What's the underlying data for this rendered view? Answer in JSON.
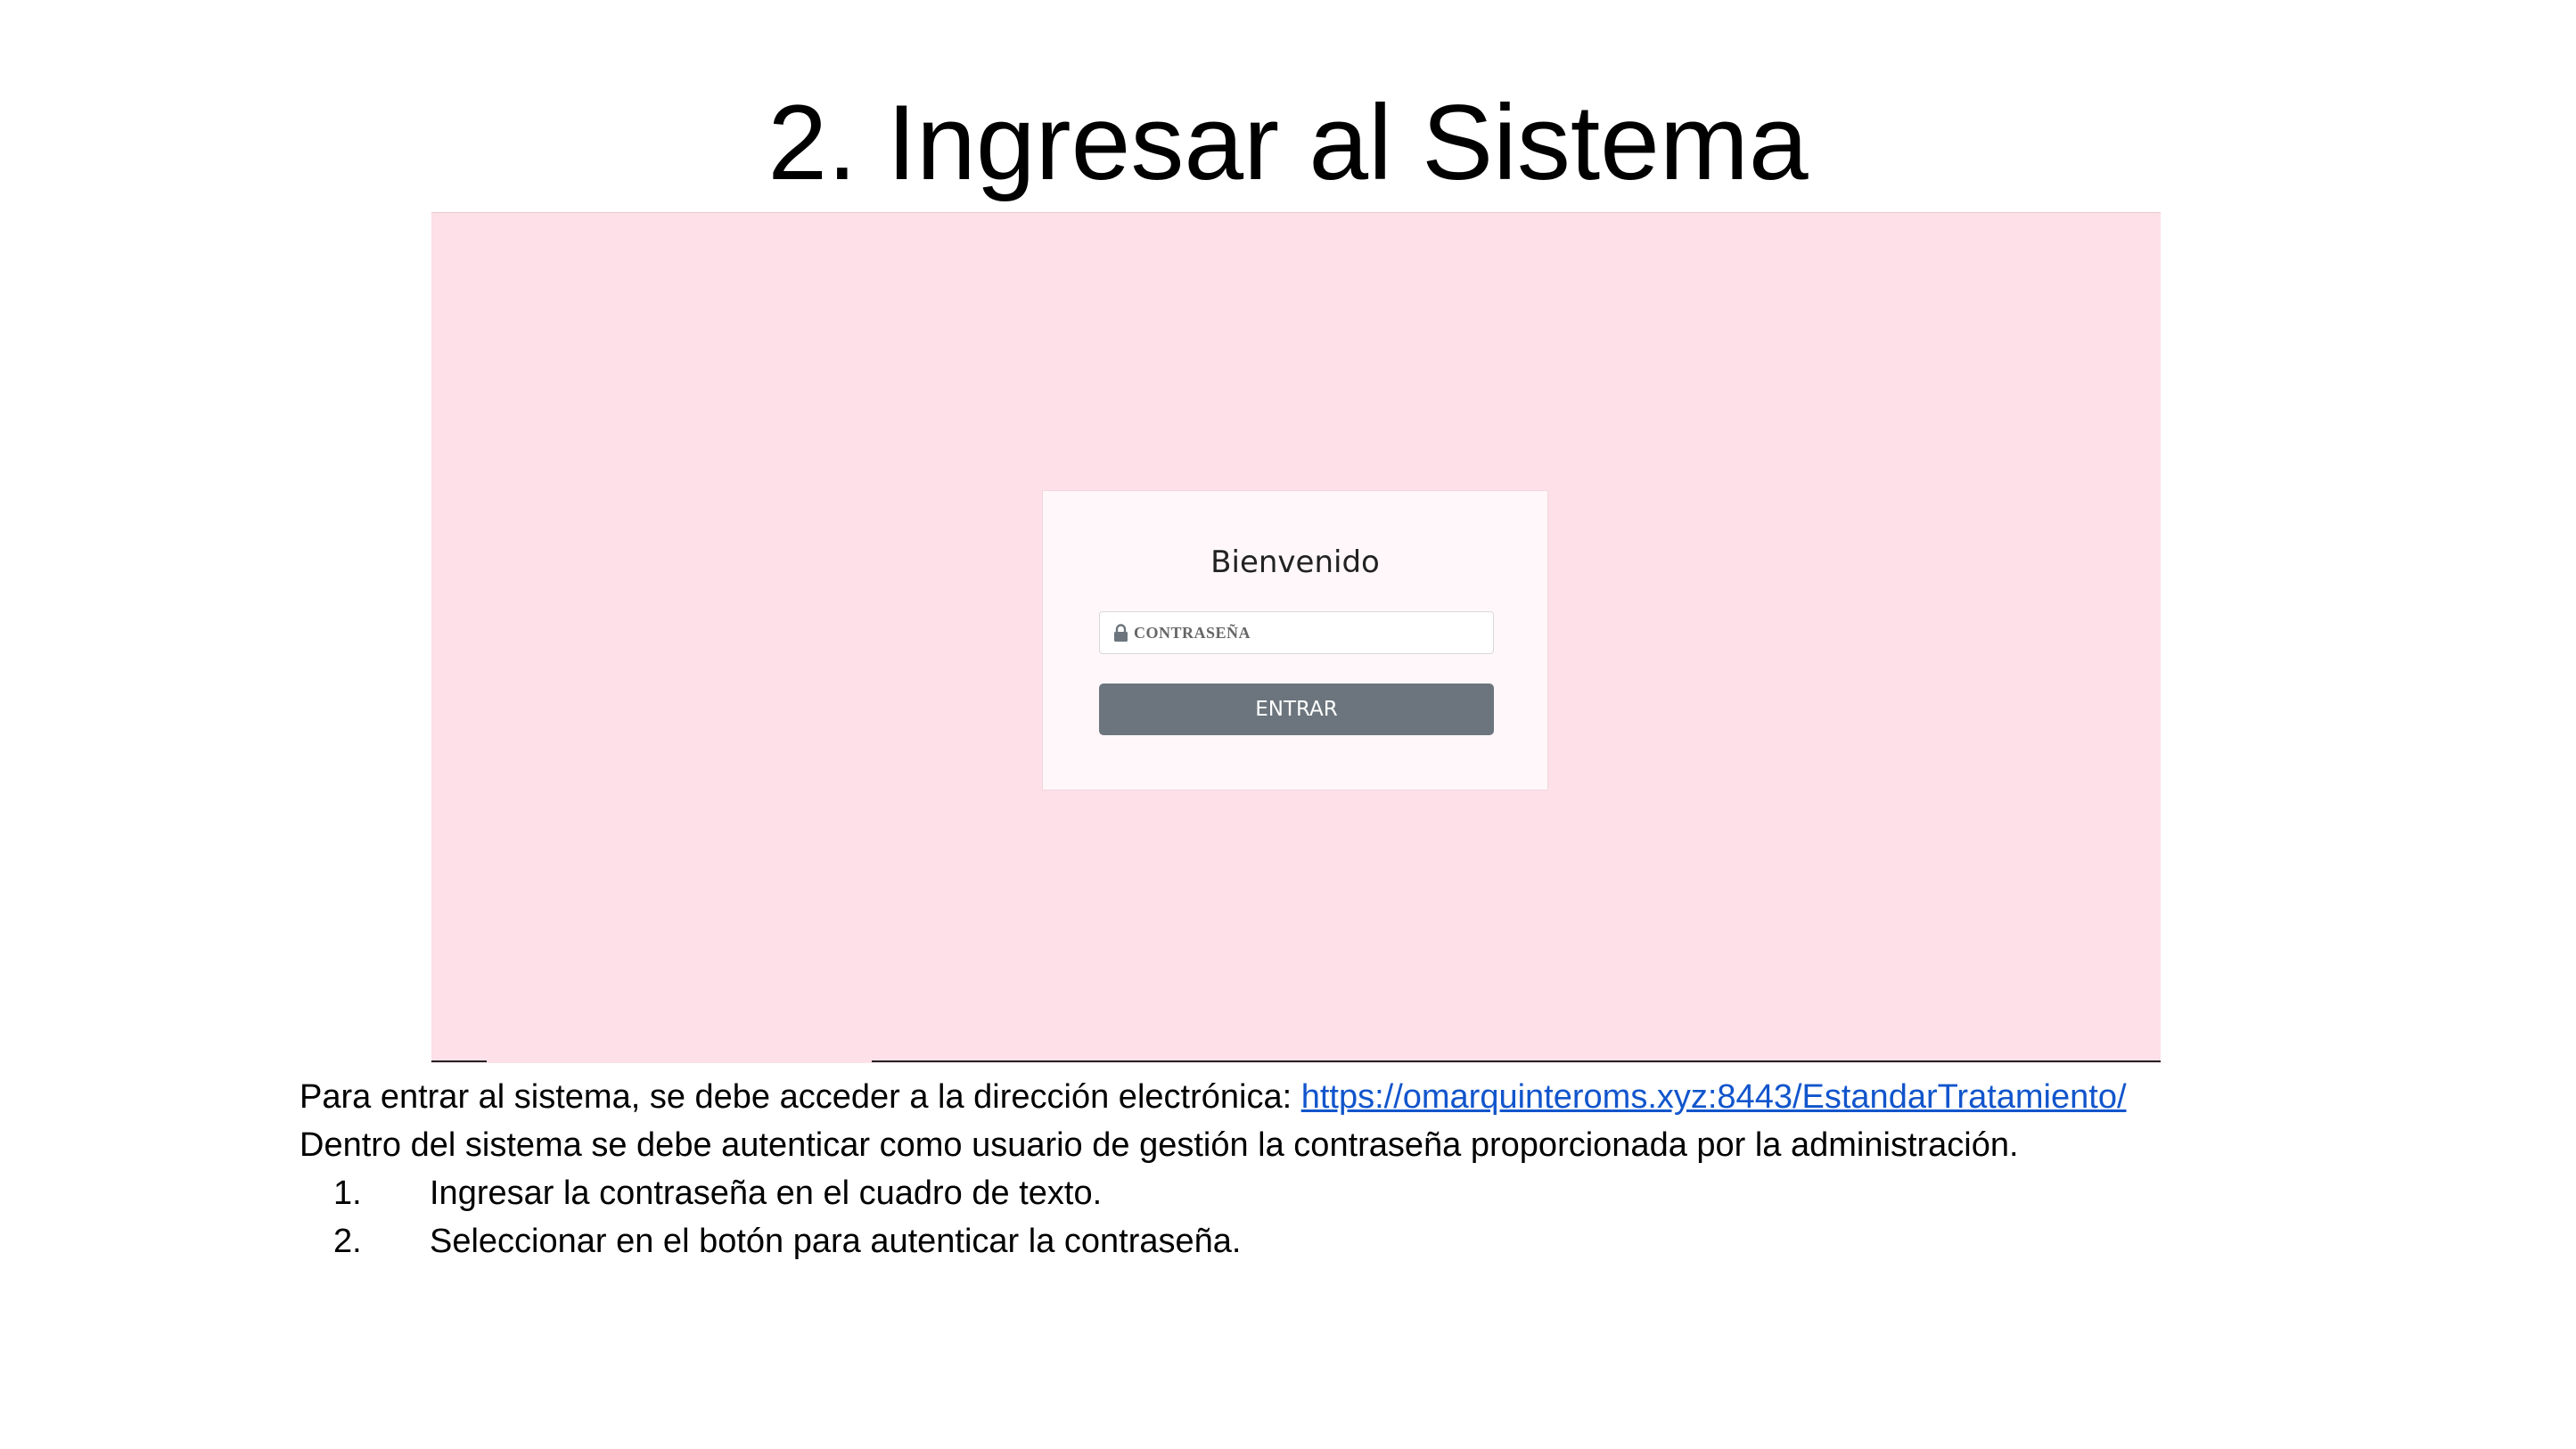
{
  "slide": {
    "title": "2. Ingresar al Sistema"
  },
  "login_screen": {
    "heading": "Bienvenido",
    "password_placeholder": "CONTRASEÑA",
    "password_icon": "lock-icon",
    "enter_label": "ENTRAR",
    "background_color": "#fde0e8",
    "button_color": "#6c757d"
  },
  "instructions": {
    "intro_prefix": "Para entrar al sistema, se  debe acceder a la dirección electrónica: ",
    "url": "https://omarquinteroms.xyz:8443/EstandarTratamiento/",
    "auth_text": "Dentro del sistema se debe autenticar como usuario de gestión la contraseña proporcionada por la administración.",
    "steps": [
      {
        "number": "1.",
        "text": "Ingresar la contraseña en el cuadro de texto."
      },
      {
        "number": "2.",
        "text": "Seleccionar en el botón para autenticar la contraseña."
      }
    ],
    "link_color": "#1155cc"
  }
}
